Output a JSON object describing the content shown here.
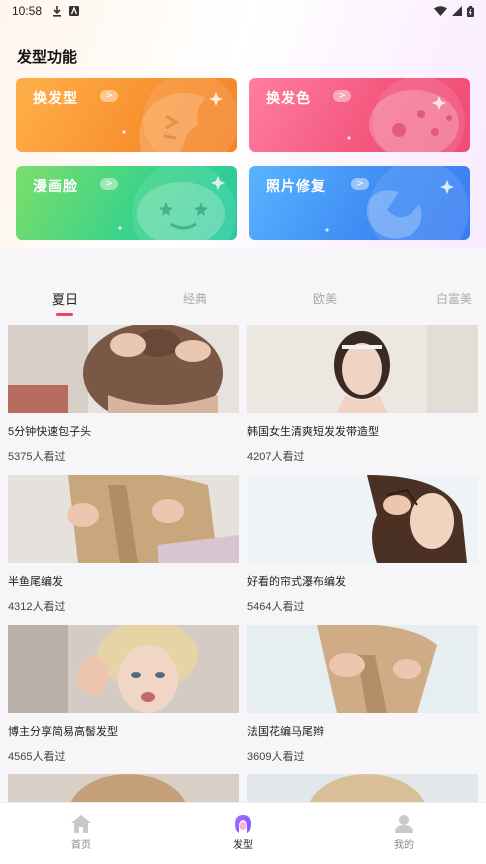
{
  "status_bar": {
    "time": "10:58"
  },
  "section": {
    "title": "发型功能"
  },
  "features": [
    {
      "label": "换发型",
      "arrow": ">",
      "icon": "face-icon"
    },
    {
      "label": "换发色",
      "arrow": ">",
      "icon": "palette-icon"
    },
    {
      "label": "漫画脸",
      "arrow": ">",
      "icon": "cartoon-face-icon"
    },
    {
      "label": "照片修复",
      "arrow": ">",
      "icon": "repair-wrench-icon"
    }
  ],
  "tabs": [
    {
      "label": "夏日",
      "active": true
    },
    {
      "label": "经典",
      "active": false
    },
    {
      "label": "欧美",
      "active": false
    },
    {
      "label": "白富美",
      "active": false
    }
  ],
  "videos": [
    {
      "title": "5分钟快速包子头",
      "views": "5375人看过"
    },
    {
      "title": "韩国女生清爽短发发带造型",
      "views": "4207人看过"
    },
    {
      "title": "半鱼尾编发",
      "views": "4312人看过"
    },
    {
      "title": "好看的帘式瀑布编发",
      "views": "5464人看过"
    },
    {
      "title": "博主分享简易高髻发型",
      "views": "4565人看过"
    },
    {
      "title": "法国花编马尾辫",
      "views": "3609人看过"
    }
  ],
  "bottom_nav": [
    {
      "label": "首页",
      "icon": "home-icon",
      "active": false
    },
    {
      "label": "发型",
      "icon": "hairstyle-icon",
      "active": true
    },
    {
      "label": "我的",
      "icon": "profile-icon",
      "active": false
    }
  ],
  "colors": {
    "accent": "#f1465a",
    "card_orange": "#f7922f",
    "card_pink": "#f2557d",
    "card_green": "#2fcf8e",
    "card_blue": "#3f8df5"
  }
}
